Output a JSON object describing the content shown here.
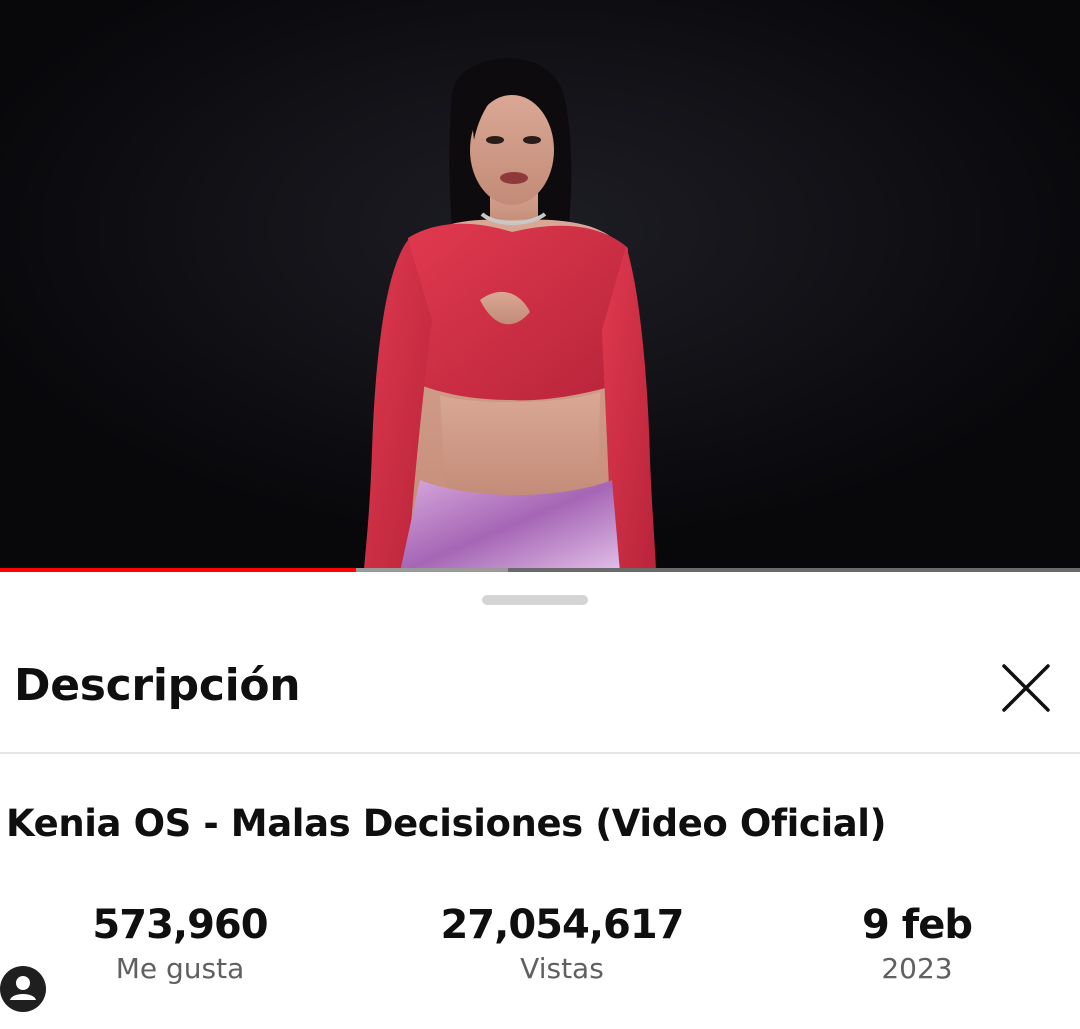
{
  "video": {
    "progress": 0.33,
    "buffered": 0.47,
    "progress_color": "#ff0000",
    "thumbnail_subject": "performer-in-red-crop-top-and-metallic-pink-pants"
  },
  "sheet": {
    "title": "Descripción",
    "close_icon": "close-icon",
    "drag_handle": "drag-handle"
  },
  "description": {
    "video_title": "Kenia OS - Malas Decisiones (Video Oficial)",
    "stats": [
      {
        "value": "573,960",
        "label": "Me gusta"
      },
      {
        "value": "27,054,617",
        "label": "Vistas"
      },
      {
        "value": "9 feb",
        "label": "2023"
      }
    ]
  },
  "overlay": {
    "avatar_icon": "user-avatar-icon"
  }
}
